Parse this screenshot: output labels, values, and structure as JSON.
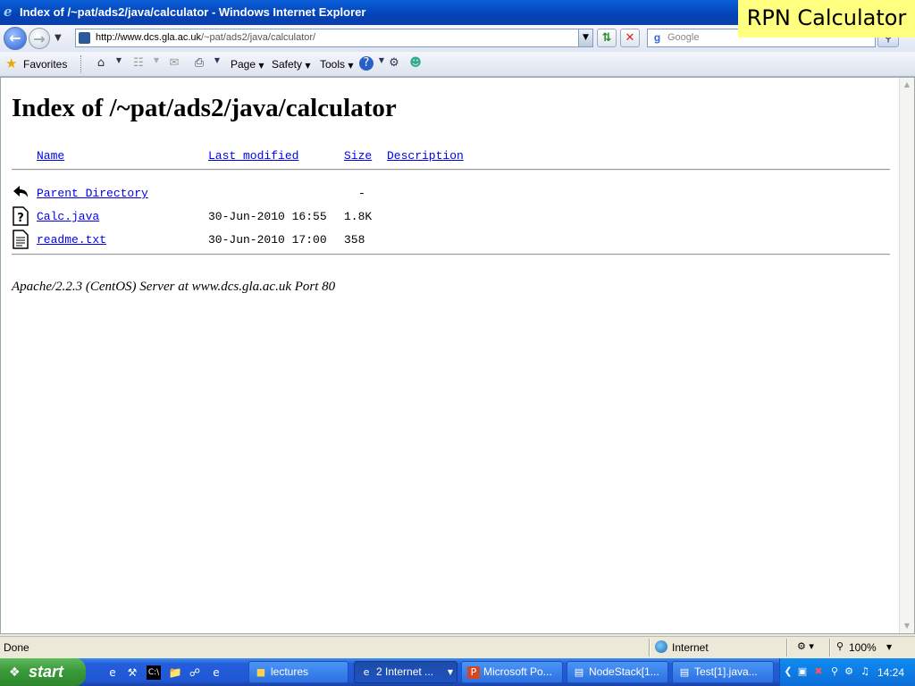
{
  "window": {
    "title": "Index of /~pat/ads2/java/calculator - Windows Internet Explorer"
  },
  "overlay": {
    "label": "RPN Calculator"
  },
  "address_bar": {
    "url_host": "http://www.dcs.gla.ac.uk",
    "url_path": "/~pat/ads2/java/calculator/"
  },
  "search": {
    "placeholder": "Google"
  },
  "command_bar": {
    "favorites": "Favorites",
    "page": "Page",
    "safety": "Safety",
    "tools": "Tools"
  },
  "page": {
    "heading": "Index of /~pat/ads2/java/calculator",
    "columns": {
      "name": "Name",
      "last_modified": "Last modified",
      "size": "Size",
      "description": "Description"
    },
    "rows": [
      {
        "name": "Parent Directory",
        "modified": "",
        "size": "-",
        "icon": "back-arrow-icon"
      },
      {
        "name": "Calc.java",
        "modified": "30-Jun-2010 16:55",
        "size": "1.8K",
        "icon": "unknown-file-icon"
      },
      {
        "name": "readme.txt",
        "modified": "30-Jun-2010 17:00",
        "size": "358",
        "icon": "text-file-icon"
      }
    ],
    "server_signature": "Apache/2.2.3 (CentOS) Server at www.dcs.gla.ac.uk Port 80"
  },
  "status_bar": {
    "status": "Done",
    "zone": "Internet",
    "zoom": "100%"
  },
  "taskbar": {
    "start": "start",
    "tasks": [
      {
        "label": "lectures",
        "icon": "folder-icon",
        "active": false
      },
      {
        "label": "2 Internet ...",
        "icon": "ie-icon",
        "active": true
      },
      {
        "label": "Microsoft Po...",
        "icon": "powerpoint-icon",
        "active": false
      },
      {
        "label": "NodeStack[1...",
        "icon": "notepad-icon",
        "active": false
      },
      {
        "label": "Test[1].java...",
        "icon": "notepad-icon",
        "active": false
      }
    ],
    "clock": "14:24"
  }
}
